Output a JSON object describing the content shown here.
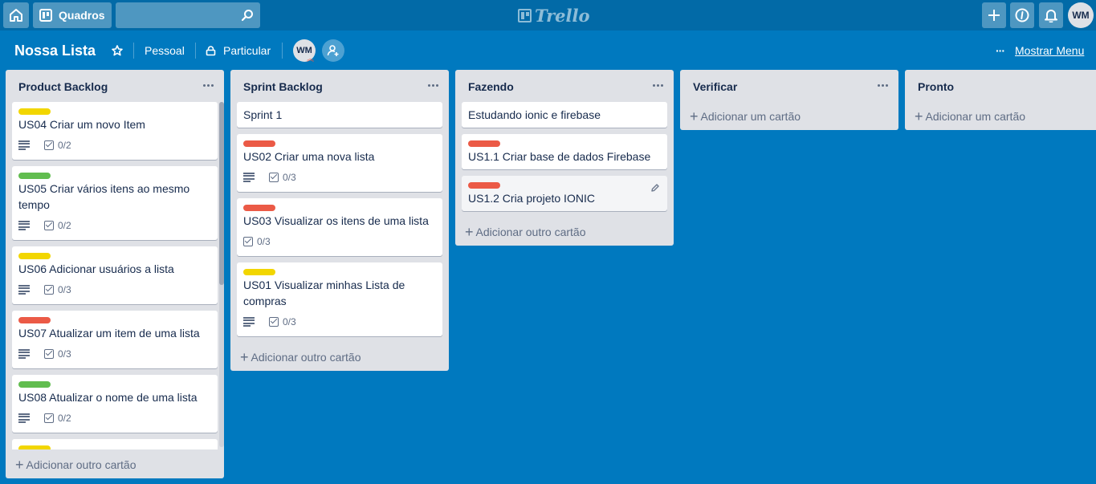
{
  "header": {
    "boards_label": "Quadros",
    "search_value": "",
    "logo_text": "Trello",
    "user_initials": "WM"
  },
  "board": {
    "title": "Nossa Lista",
    "team": "Pessoal",
    "visibility": "Particular",
    "member_initials": "WM",
    "menu_label": "Mostrar Menu"
  },
  "colors": {
    "background": "#0079bf",
    "label_yellow": "#f2d600",
    "label_green": "#61bd4f",
    "label_red": "#eb5a46"
  },
  "lists": [
    {
      "title": "Product Backlog",
      "add_label": "Adicionar outro cartão",
      "cards": [
        {
          "label": "yellow",
          "title": "US04 Criar um novo Item",
          "checklist": "0/2"
        },
        {
          "label": "green",
          "title": "US05 Criar vários itens ao mesmo tempo",
          "checklist": "0/2"
        },
        {
          "label": "yellow",
          "title": "US06 Adicionar usuários a lista",
          "checklist": "0/3"
        },
        {
          "label": "red",
          "title": "US07 Atualizar um item de uma lista",
          "checklist": "0/3"
        },
        {
          "label": "green",
          "title": "US08 Atualizar o nome de uma lista",
          "checklist": "0/2"
        },
        {
          "label": "yellow",
          "title": "",
          "checklist": ""
        }
      ]
    },
    {
      "title": "Sprint Backlog",
      "add_label": "Adicionar outro cartão",
      "cards": [
        {
          "label": "",
          "title": "Sprint 1",
          "checklist": ""
        },
        {
          "label": "red",
          "title": "US02 Criar uma nova lista",
          "checklist": "0/3"
        },
        {
          "label": "red",
          "title": "US03 Visualizar os itens de uma lista",
          "checklist": "0/3"
        },
        {
          "label": "yellow",
          "title": "US01 Visualizar minhas Lista de compras",
          "checklist": "0/3"
        }
      ]
    },
    {
      "title": "Fazendo",
      "add_label": "Adicionar outro cartão",
      "cards": [
        {
          "label": "",
          "title": "Estudando ionic e firebase",
          "checklist": ""
        },
        {
          "label": "red",
          "title": "US1.1 Criar base de dados Firebase",
          "checklist": ""
        },
        {
          "label": "red",
          "title": "US1.2 Cria projeto IONIC",
          "checklist": ""
        }
      ]
    },
    {
      "title": "Verificar",
      "add_label": "Adicionar um cartão",
      "cards": []
    },
    {
      "title": "Pronto",
      "add_label": "Adicionar um cartão",
      "cards": []
    }
  ]
}
